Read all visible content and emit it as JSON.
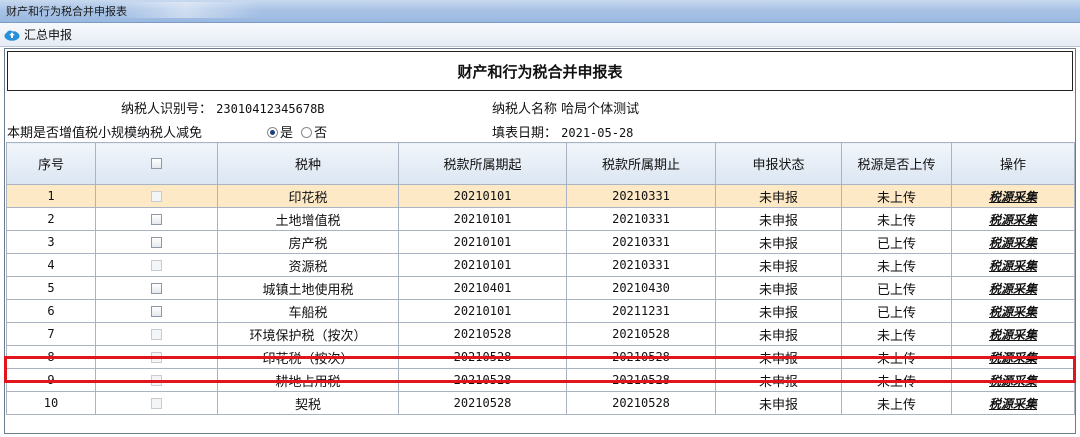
{
  "window": {
    "title": "财产和行为税合并申报表"
  },
  "toolbar": {
    "summary_button": "汇总申报"
  },
  "report": {
    "title": "财产和行为税合并申报表",
    "taxpayer_id_label": "纳税人识别号：",
    "taxpayer_id": "23010412345678B",
    "taxpayer_name_label": "纳税人名称",
    "taxpayer_name": "哈局个体测试",
    "reduction_label": "本期是否增值税小规模纳税人减免",
    "option_yes": "是",
    "option_no": "否",
    "selected_option": "是",
    "fill_date_label": "填表日期：",
    "fill_date": "2021-05-28"
  },
  "table": {
    "headers": {
      "seq": "序号",
      "tax_type": "税种",
      "period_start": "税款所属期起",
      "period_end": "税款所属期止",
      "status": "申报状态",
      "upload": "税源是否上传",
      "action": "操作"
    },
    "rows": [
      {
        "seq": "1",
        "tax_type": "印花税",
        "start": "20210101",
        "end": "20210331",
        "status": "未申报",
        "upload": "未上传",
        "action": "税源采集",
        "checkbox_enabled": false
      },
      {
        "seq": "2",
        "tax_type": "土地增值税",
        "start": "20210101",
        "end": "20210331",
        "status": "未申报",
        "upload": "未上传",
        "action": "税源采集",
        "checkbox_enabled": true
      },
      {
        "seq": "3",
        "tax_type": "房产税",
        "start": "20210101",
        "end": "20210331",
        "status": "未申报",
        "upload": "已上传",
        "action": "税源采集",
        "checkbox_enabled": true
      },
      {
        "seq": "4",
        "tax_type": "资源税",
        "start": "20210101",
        "end": "20210331",
        "status": "未申报",
        "upload": "未上传",
        "action": "税源采集",
        "checkbox_enabled": false
      },
      {
        "seq": "5",
        "tax_type": "城镇土地使用税",
        "start": "20210401",
        "end": "20210430",
        "status": "未申报",
        "upload": "已上传",
        "action": "税源采集",
        "checkbox_enabled": true
      },
      {
        "seq": "6",
        "tax_type": "车船税",
        "start": "20210101",
        "end": "20211231",
        "status": "未申报",
        "upload": "已上传",
        "action": "税源采集",
        "checkbox_enabled": true
      },
      {
        "seq": "7",
        "tax_type": "环境保护税（按次）",
        "start": "20210528",
        "end": "20210528",
        "status": "未申报",
        "upload": "未上传",
        "action": "税源采集",
        "checkbox_enabled": false
      },
      {
        "seq": "8",
        "tax_type": "印花税（按次）",
        "start": "20210528",
        "end": "20210528",
        "status": "未申报",
        "upload": "未上传",
        "action": "税源采集",
        "checkbox_enabled": false
      },
      {
        "seq": "9",
        "tax_type": "耕地占用税",
        "start": "20210528",
        "end": "20210528",
        "status": "未申报",
        "upload": "未上传",
        "action": "税源采集",
        "checkbox_enabled": false
      },
      {
        "seq": "10",
        "tax_type": "契税",
        "start": "20210528",
        "end": "20210528",
        "status": "未申报",
        "upload": "未上传",
        "action": "税源采集",
        "checkbox_enabled": false
      }
    ],
    "selected_row": "1"
  },
  "colors": {
    "selected_row_bg": "#fde9c6",
    "highlight_border": "#e0161c",
    "toolbar_icon": "#2a8fd9"
  },
  "icons": {
    "summary": "cloud-upload-icon"
  }
}
